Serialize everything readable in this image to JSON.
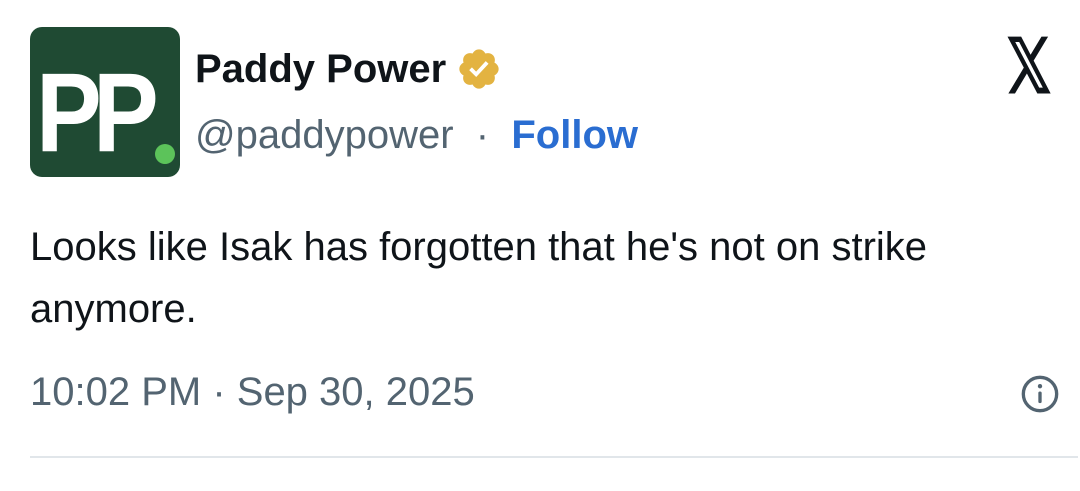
{
  "author": {
    "avatar_text": "PP",
    "name": "Paddy Power",
    "handle": "@paddypower",
    "separator": "·",
    "follow_label": "Follow",
    "verified_icon": "verified-badge-icon",
    "avatar_bg": "#1f4a33",
    "avatar_dot_color": "#5cc35a",
    "badge_color": "#e3b341"
  },
  "tweet": {
    "text": "Looks like Isak has forgotten that he's not on strike anymore.",
    "timestamp": "10:02 PM · Sep 30, 2025"
  },
  "icons": {
    "platform_logo": "x-logo-icon",
    "info": "info-icon"
  },
  "colors": {
    "follow_link": "#2a6dd1",
    "secondary_text": "#536471",
    "primary_text": "#0f1419"
  }
}
